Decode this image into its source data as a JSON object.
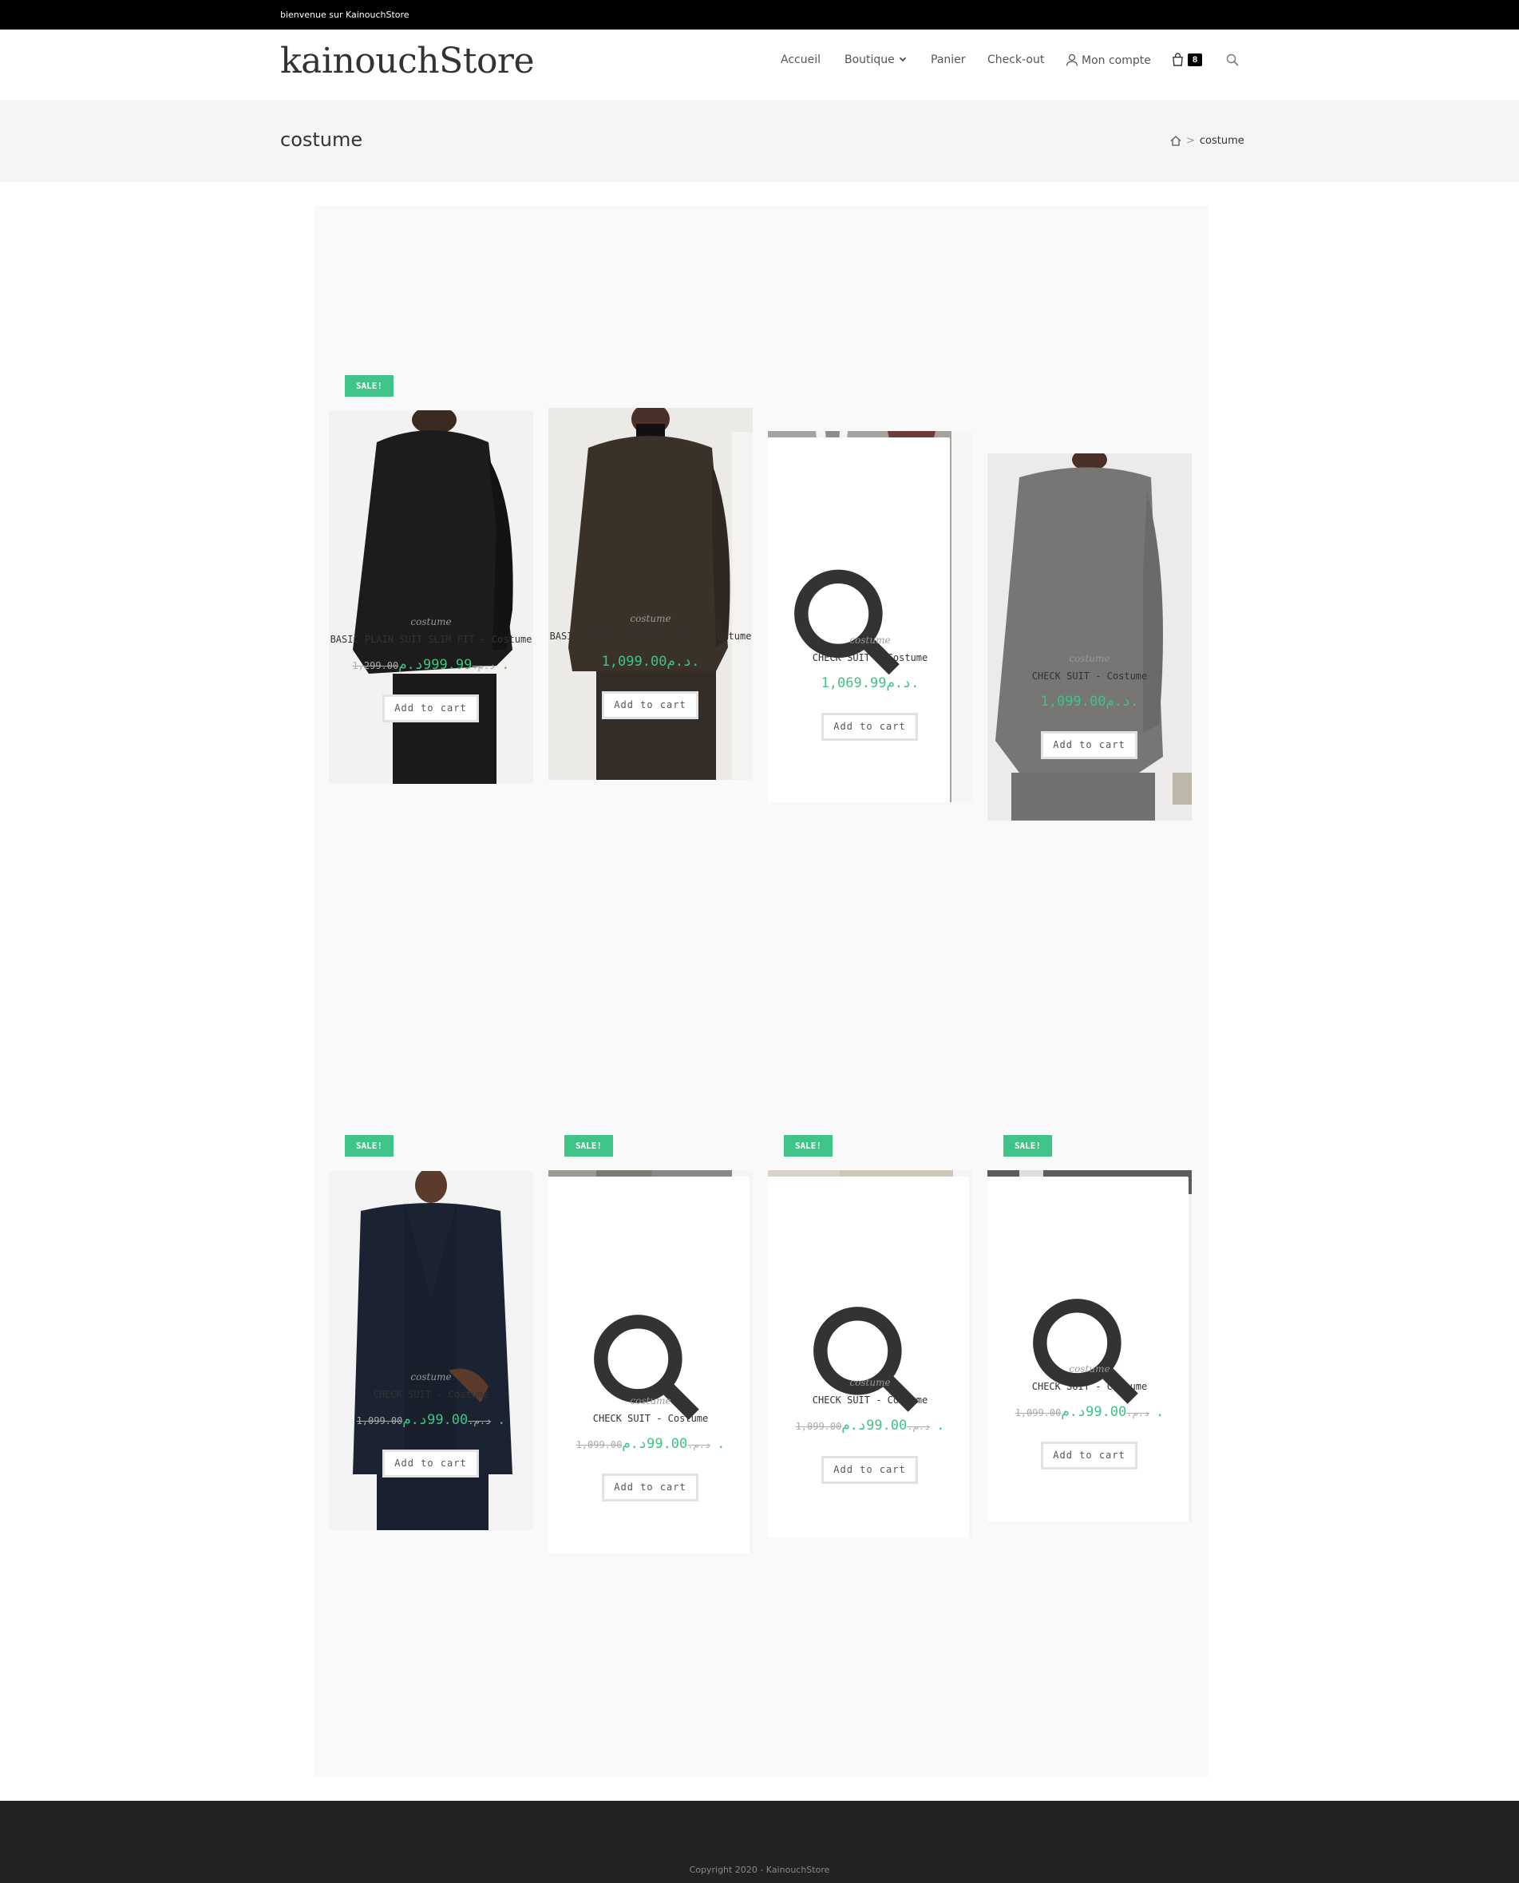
{
  "topbar": {
    "text": "bienvenue sur KainouchStore"
  },
  "header": {
    "logo": "kainouchStore",
    "nav": {
      "accueil": "Accueil",
      "boutique": "Boutique",
      "panier": "Panier",
      "checkout": "Check-out",
      "account": "Mon compte"
    },
    "cart_count": "8"
  },
  "page": {
    "title": "costume",
    "breadcrumb_current": "costume"
  },
  "products": [
    {
      "sale": "SALE!",
      "category": "costume",
      "name": "BASIC PLAIN SUIT SLIM FIT - Costume",
      "old_price": "1,299.00د.م.",
      "price": "999.99د.م.",
      "button": "Add to cart"
    },
    {
      "sale": "",
      "category": "costume",
      "name": "BASIC PLAIN SUIT SLIM FIT - Costume",
      "old_price": "",
      "price": "1,099.00د.م.",
      "button": "Add to cart"
    },
    {
      "sale": "",
      "category": "costume",
      "name": "CHECK SUIT - Costume",
      "old_price": "",
      "price": "1,069.99د.م.",
      "button": "Add to cart"
    },
    {
      "sale": "",
      "category": "costume",
      "name": "CHECK SUIT - Costume",
      "old_price": "",
      "price": "1,099.00د.م.",
      "button": "Add to cart"
    },
    {
      "sale": "SALE!",
      "category": "costume",
      "name": "CHECK SUIT - Costume",
      "old_price": "1,099.00د.م.",
      "price": "99.00د.م.",
      "button": "Add to cart"
    },
    {
      "sale": "SALE!",
      "category": "costume",
      "name": "CHECK SUIT - Costume",
      "old_price": "1,099.00د.م.",
      "price": "99.00د.م.",
      "button": "Add to cart"
    },
    {
      "sale": "SALE!",
      "category": "costume",
      "name": "CHECK SUIT - Costume",
      "old_price": "1,099.00د.م.",
      "price": "99.00د.م.",
      "button": "Add to cart"
    },
    {
      "sale": "SALE!",
      "category": "costume",
      "name": "CHECK SUIT - Costume",
      "old_price": "1,099.00د.م.",
      "price": "99.00د.م.",
      "button": "Add to cart"
    }
  ],
  "footer": {
    "copyright": "Copyright 2020 - KainouchStore"
  },
  "colors": {
    "accent_green": "#3fc387",
    "topbar": "#000000",
    "footer": "#222222"
  }
}
